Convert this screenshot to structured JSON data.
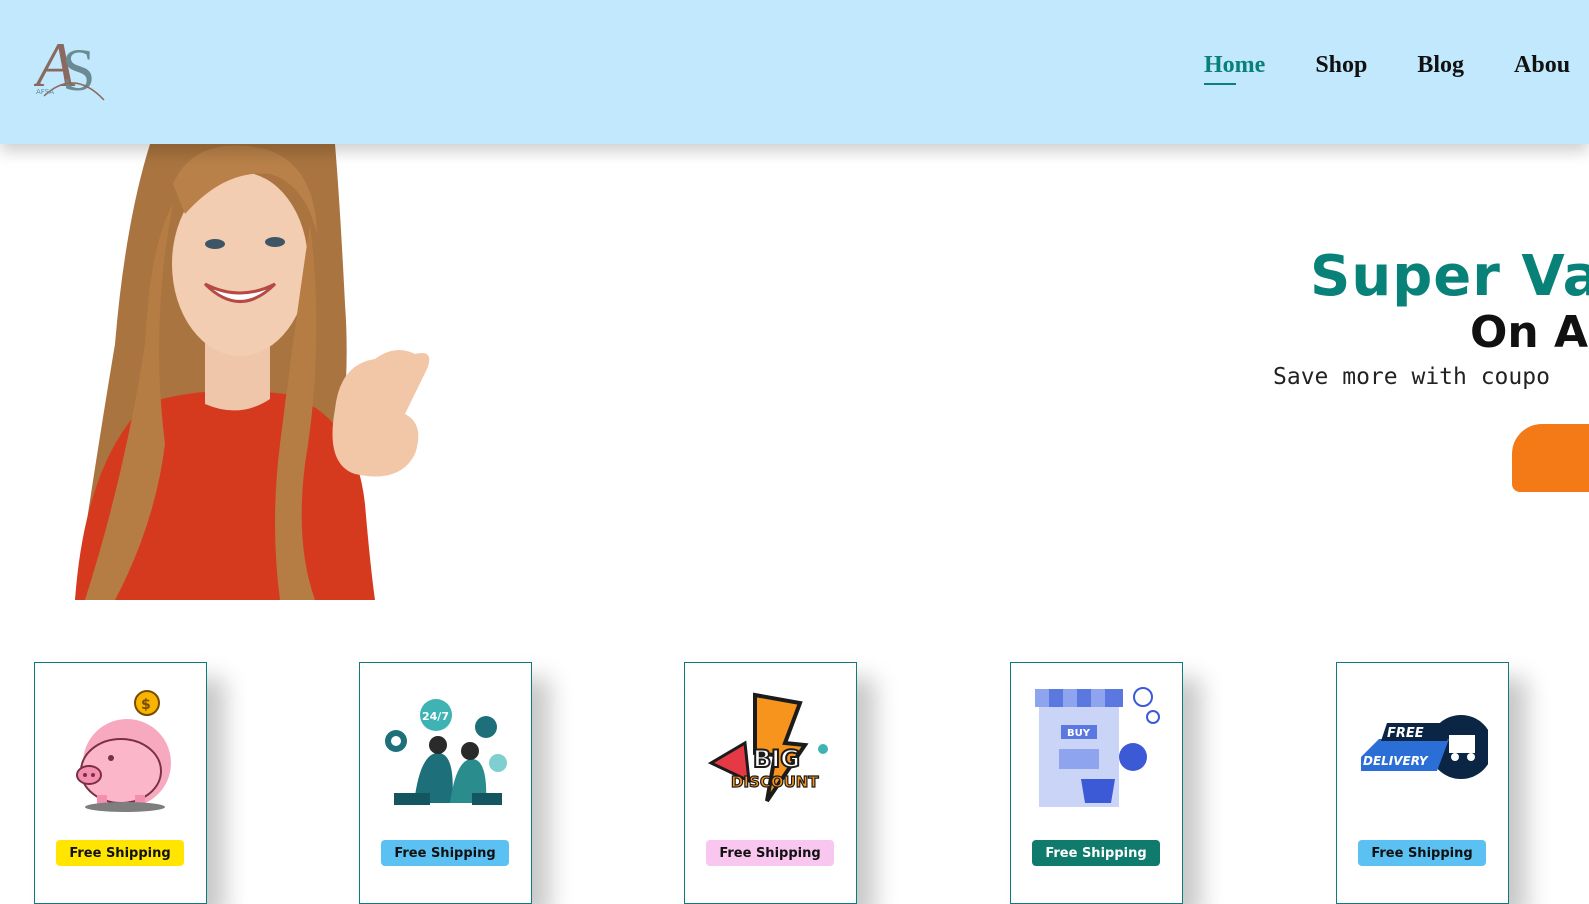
{
  "header": {
    "logo_text": "AS",
    "logo_subtext": "AFSA",
    "nav": [
      {
        "label": "Home",
        "active": true
      },
      {
        "label": "Shop",
        "active": false
      },
      {
        "label": "Blog",
        "active": false
      },
      {
        "label": "Abou",
        "active": false
      }
    ]
  },
  "hero": {
    "title": "Super Va",
    "subtitle": "On A",
    "text": "Save more with coupo",
    "button_color": "#f47a17"
  },
  "features": [
    {
      "icon": "piggy-bank-icon",
      "badge": "Free Shipping",
      "badge_color": "#ffe500"
    },
    {
      "icon": "support-24-7-icon",
      "badge": "Free Shipping",
      "badge_color": "#5bc0f2"
    },
    {
      "icon": "big-discount-icon",
      "badge": "Free Shipping",
      "badge_color": "#f9c6f0"
    },
    {
      "icon": "shopping-store-icon",
      "badge": "Free Shipping",
      "badge_color": "#0f7b6c"
    },
    {
      "icon": "free-delivery-icon",
      "badge": "Free Shipping",
      "badge_color": "#5bc0f2"
    }
  ],
  "illustrations": {
    "support_badge": "24/7",
    "discount_big": "BIG",
    "discount_word": "DISCOUNT",
    "store_sign": "BUY",
    "delivery_free": "FREE",
    "delivery_word": "DELIVERY"
  },
  "colors": {
    "accent": "#088178",
    "header_bg": "#c1e8fc"
  }
}
